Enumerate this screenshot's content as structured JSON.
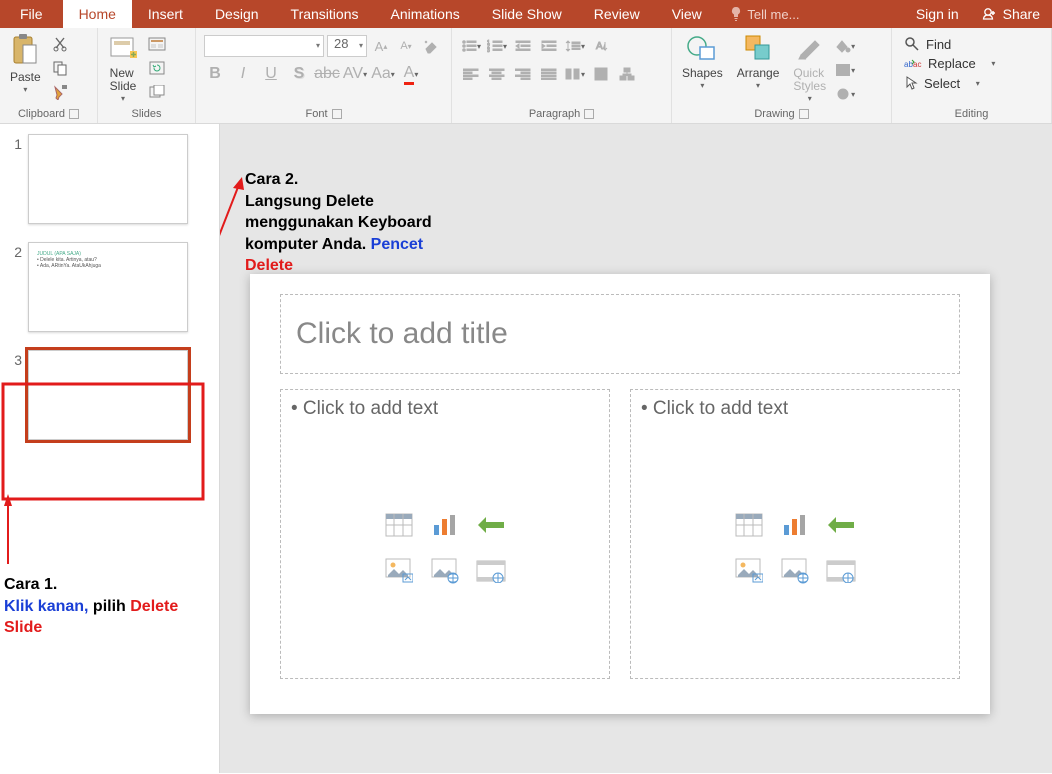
{
  "tabs": {
    "file": "File",
    "home": "Home",
    "insert": "Insert",
    "design": "Design",
    "transitions": "Transitions",
    "animations": "Animations",
    "slideshow": "Slide Show",
    "review": "Review",
    "view": "View"
  },
  "tellme": "Tell me...",
  "signin": "Sign in",
  "share": "Share",
  "groups": {
    "clipboard": {
      "label": "Clipboard",
      "paste": "Paste"
    },
    "slides": {
      "label": "Slides",
      "new": "New\nSlide"
    },
    "font": {
      "label": "Font",
      "name": "",
      "size": "28"
    },
    "paragraph": {
      "label": "Paragraph"
    },
    "drawing": {
      "label": "Drawing",
      "shapes": "Shapes",
      "arrange": "Arrange",
      "quick": "Quick\nStyles"
    },
    "editing": {
      "label": "Editing",
      "find": "Find",
      "replace": "Replace",
      "select": "Select"
    }
  },
  "thumbs": [
    {
      "n": "1"
    },
    {
      "n": "2",
      "title": "JUDUL (APA SAJA)",
      "b1": "• Delele kita. Artinya, atau?",
      "b2": "• Ada, ARtinYa. AtaUkAhjuga"
    },
    {
      "n": "3"
    }
  ],
  "slide": {
    "title_ph": "Click to add title",
    "text_ph": "• Click to add text"
  },
  "annotations": {
    "c1_head": "Cara 1.",
    "c1_klik": "Klik kanan, ",
    "c1_pilih": "pilih ",
    "c1_del": "Delete Slide",
    "c2_head": "Cara 2.",
    "c2_body": "Langsung Delete menggunakan Keyboard komputer Anda. ",
    "c2_pencet": "Pencet ",
    "c2_del": "Delete"
  }
}
